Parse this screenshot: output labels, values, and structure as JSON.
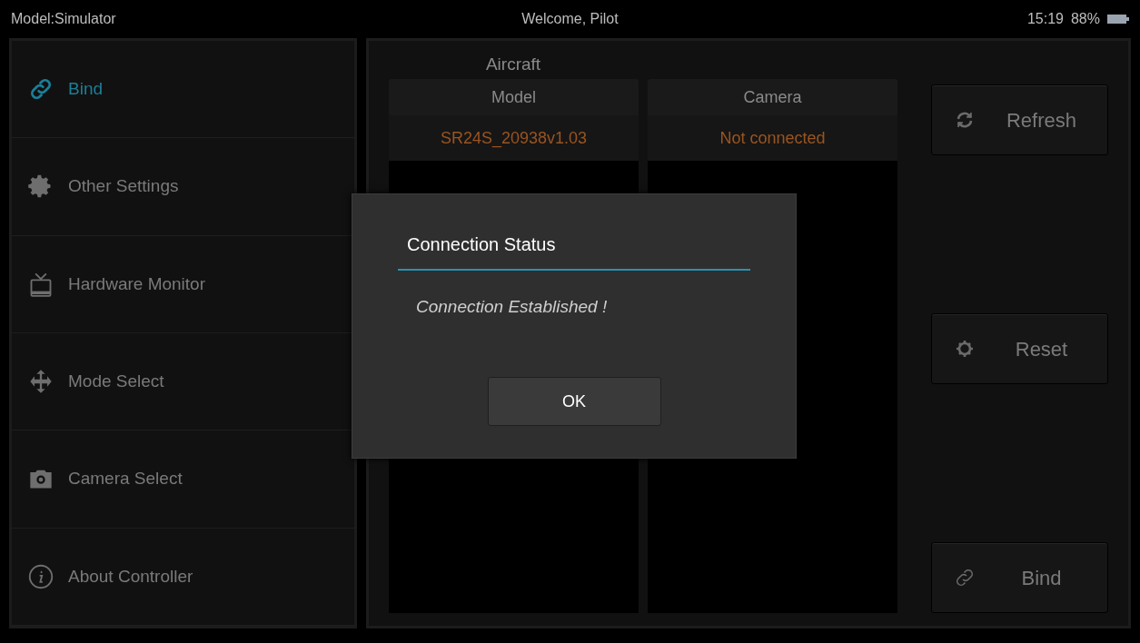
{
  "status_bar": {
    "model": "Model:Simulator",
    "welcome": "Welcome, Pilot",
    "time": "15:19",
    "battery": "88%"
  },
  "sidebar": {
    "items": [
      {
        "label": "Bind",
        "selected": true
      },
      {
        "label": "Other Settings",
        "selected": false
      },
      {
        "label": "Hardware Monitor",
        "selected": false
      },
      {
        "label": "Mode Select",
        "selected": false
      },
      {
        "label": "Camera Select",
        "selected": false
      },
      {
        "label": "About Controller",
        "selected": false
      }
    ]
  },
  "aircraft": {
    "title": "Aircraft",
    "columns": [
      {
        "header": "Model",
        "value": "SR24S_20938v1.03"
      },
      {
        "header": "Camera",
        "value": "Not connected"
      }
    ]
  },
  "buttons": [
    "Refresh",
    "Reset",
    "Bind"
  ],
  "dialog": {
    "title": "Connection Status",
    "message": "Connection Established !",
    "button": "OK"
  }
}
